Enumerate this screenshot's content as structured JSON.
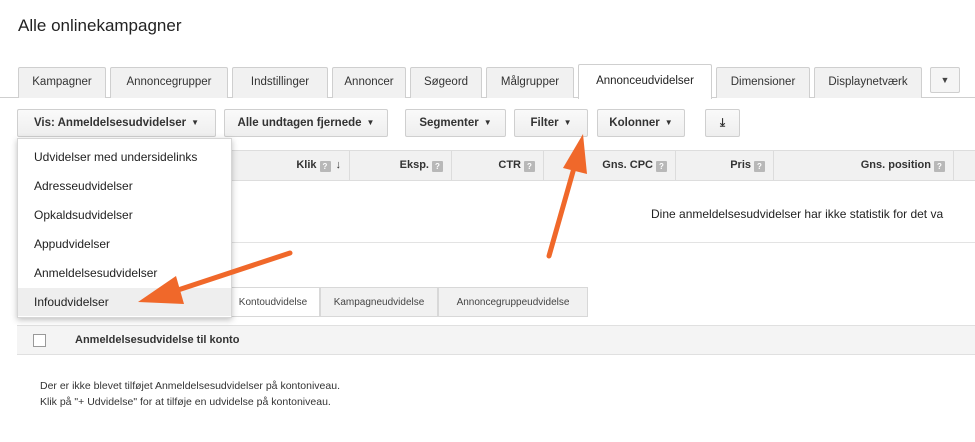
{
  "page_title": "Alle onlinekampagner",
  "tabs": [
    {
      "label": "Kampagner",
      "active": false
    },
    {
      "label": "Annoncegrupper",
      "active": false
    },
    {
      "label": "Indstillinger",
      "active": false
    },
    {
      "label": "Annoncer",
      "active": false
    },
    {
      "label": "Søgeord",
      "active": false
    },
    {
      "label": "Målgrupper",
      "active": false
    },
    {
      "label": "Annonceudvidelser",
      "active": true
    },
    {
      "label": "Dimensioner",
      "active": false
    },
    {
      "label": "Displaynetværk",
      "active": false
    }
  ],
  "tab_more_icon": "▼",
  "toolbar": {
    "view_select": "Vis: Anmeldelsesudvidelser",
    "status_filter": "Alle undtagen fjernede",
    "segments": "Segmenter",
    "filter": "Filter",
    "columns": "Kolonner",
    "download_icon": "⤓",
    "caret": "▼"
  },
  "table": {
    "columns": [
      {
        "label": "Klik",
        "help": "?",
        "sorted": "↓"
      },
      {
        "label": "Eksp.",
        "help": "?"
      },
      {
        "label": "CTR",
        "help": "?"
      },
      {
        "label": "Gns. CPC",
        "help": "?"
      },
      {
        "label": "Pris",
        "help": "?"
      },
      {
        "label": "Gns. position",
        "help": "?"
      }
    ],
    "no_stats_message": "Dine anmeldelsesudvidelser har ikke statistik for det va"
  },
  "dropdown": {
    "items": [
      "Udvidelser med undersidelinks",
      "Adresseudvidelser",
      "Opkaldsudvidelser",
      "Appudvidelser",
      "Anmeldelsesudvidelser",
      "Infoudvidelser"
    ],
    "highlighted_index": 5
  },
  "subtabs": [
    {
      "label": "Kontoudvidelse",
      "active": true
    },
    {
      "label": "Kampagneudvidelse",
      "active": false
    },
    {
      "label": "Annoncegruppeudvidelse",
      "active": false
    }
  ],
  "lower_table": {
    "header": "Anmeldelsesudvidelse til konto",
    "empty_line_1": "Der er ikke blevet tilføjet Anmeldelsesudvidelser på kontoniveau.",
    "empty_line_2": "Klik på \"+ Udvidelse\" for at tilføje en udvidelse på kontoniveau."
  },
  "colors": {
    "annotation_arrow": "#f0682a",
    "tab_bg": "#f1f1f1",
    "hover_bg": "#eeeeee"
  }
}
